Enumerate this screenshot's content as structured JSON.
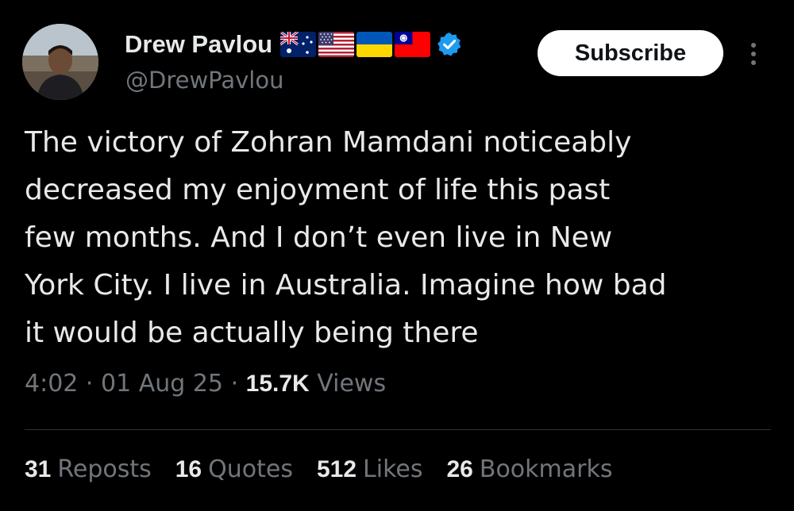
{
  "author": {
    "display_name": "Drew Pavlou",
    "handle": "@DrewPavlou",
    "flags": [
      "australia-flag",
      "usa-flag",
      "ukraine-flag",
      "taiwan-flag"
    ],
    "verified_icon": "verified-badge-icon"
  },
  "actions": {
    "subscribe_label": "Subscribe",
    "more_icon": "more-vertical-icon"
  },
  "tweet": {
    "lines": [
      "The victory of Zohran Mamdani noticeably",
      "decreased my enjoyment of life this past",
      "few months. And I don’t even live in New",
      "York City. I live in Australia. Imagine how bad",
      "it would be actually being there"
    ]
  },
  "meta": {
    "time": "4:02",
    "separator": "·",
    "date": "01 Aug 25",
    "views_count": "15.7K",
    "views_label": "Views"
  },
  "stats": {
    "reposts_count": "31",
    "reposts_label": "Reposts",
    "quotes_count": "16",
    "quotes_label": "Quotes",
    "likes_count": "512",
    "likes_label": "Likes",
    "bookmarks_count": "26",
    "bookmarks_label": "Bookmarks"
  },
  "colors": {
    "background": "#000000",
    "text_primary": "#e7e9ea",
    "text_secondary": "#71767b",
    "verified_blue": "#1d9bf0",
    "divider": "#2f3336"
  }
}
